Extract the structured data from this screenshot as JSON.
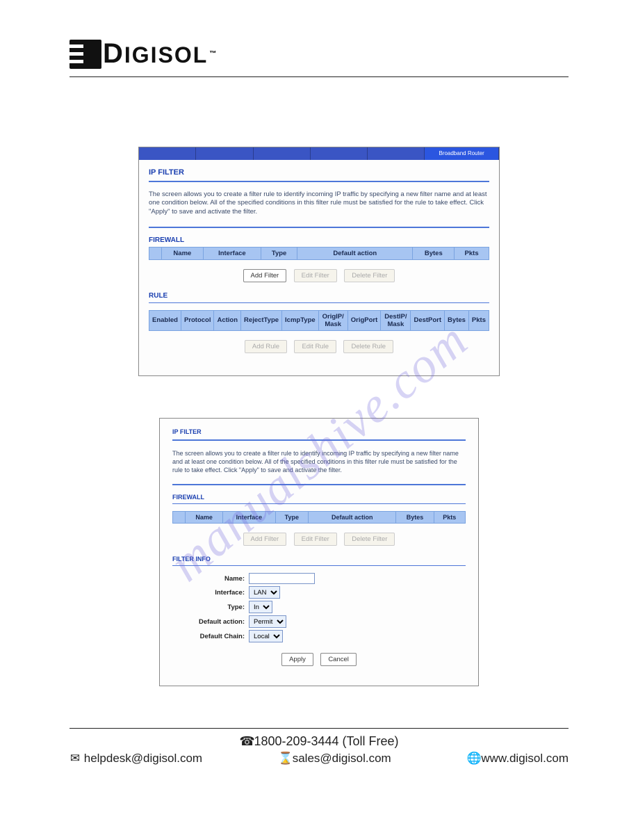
{
  "logo": {
    "text": "IGISOL",
    "tm": "™"
  },
  "watermark": "manualshive.com",
  "panel1": {
    "topbar_brand": "Broadband Router",
    "title": "IP FILTER",
    "desc": "The screen allows you to create a filter rule to identify incoming IP traffic by specifying a new filter name and at least one condition below. All of the specified conditions in this filter rule must be satisfied for the rule to take effect. Click \"Apply\" to save and activate the filter.",
    "firewall_label": "FIREWALL",
    "fw_headers": [
      "Name",
      "Interface",
      "Type",
      "Default action",
      "Bytes",
      "Pkts"
    ],
    "fw_buttons": {
      "add": "Add Filter",
      "edit": "Edit Filter",
      "del": "Delete Filter"
    },
    "rule_label": "RULE",
    "rule_headers": [
      "Enabled",
      "Protocol",
      "Action",
      "RejectType",
      "IcmpType",
      "OrigIP/ Mask",
      "OrigPort",
      "DestIP/ Mask",
      "DestPort",
      "Bytes",
      "Pkts"
    ],
    "rule_buttons": {
      "add": "Add Rule",
      "edit": "Edit Rule",
      "del": "Delete Rule"
    }
  },
  "panel2": {
    "title": "IP FILTER",
    "desc": "The screen allows you to create a filter rule to identify incoming IP traffic by specifying a new filter name and at least one condition below. All of the specified conditions in this filter rule must be satisfied for the rule to take effect. Click \"Apply\" to save and activate the filter.",
    "firewall_label": "FIREWALL",
    "fw_headers": [
      "Name",
      "Interface",
      "Type",
      "Default action",
      "Bytes",
      "Pkts"
    ],
    "fw_buttons": {
      "add": "Add Filter",
      "edit": "Edit Filter",
      "del": "Delete Filter"
    },
    "info_label": "FILTER INFO",
    "fields": {
      "name_label": "Name:",
      "name_value": "",
      "iface_label": "Interface:",
      "iface_value": "LAN",
      "type_label": "Type:",
      "type_value": "In",
      "action_label": "Default action:",
      "action_value": "Permit",
      "chain_label": "Default Chain:",
      "chain_value": "Local"
    },
    "form_buttons": {
      "apply": "Apply",
      "cancel": "Cancel"
    }
  },
  "footer": {
    "phone": "1800-209-3444 (Toll Free)",
    "helpdesk": "helpdesk@digisol.com",
    "sales": "sales@digisol.com",
    "web": "www.digisol.com"
  }
}
